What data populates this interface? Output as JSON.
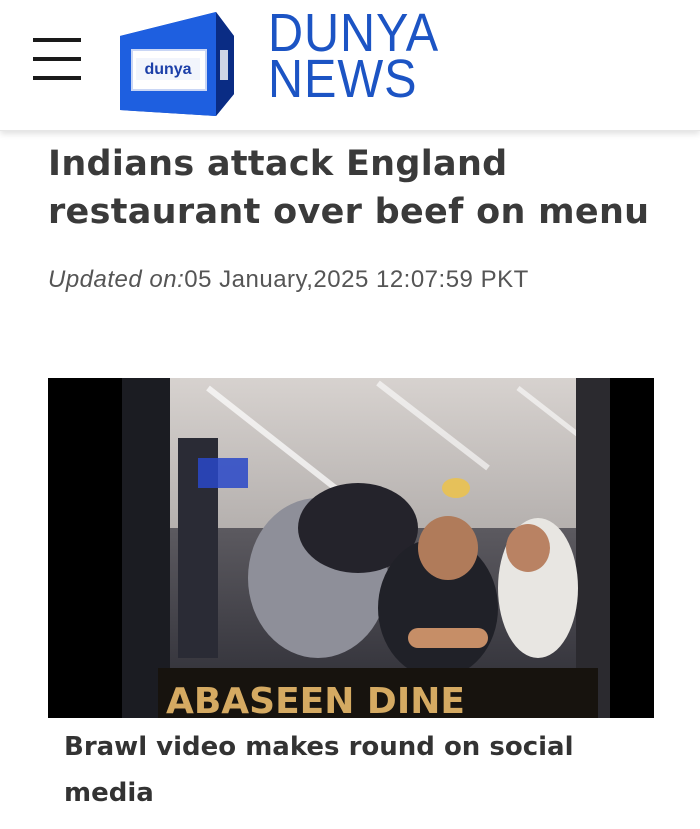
{
  "header": {
    "menu_icon": "hamburger-menu-icon",
    "logo_badge_text": "dunya",
    "brand_line1": "DUNYA",
    "brand_line2": "NEWS",
    "brand_color": "#1c54c4"
  },
  "article": {
    "headline": "Indians attack England restaurant over beef on menu",
    "updated_label": "Updated on:",
    "updated_value": "05 January,2025 12:07:59 PKT",
    "image_caption": "Brawl video makes round on social media",
    "video_overlay_text": "ABASEEN DINE"
  }
}
